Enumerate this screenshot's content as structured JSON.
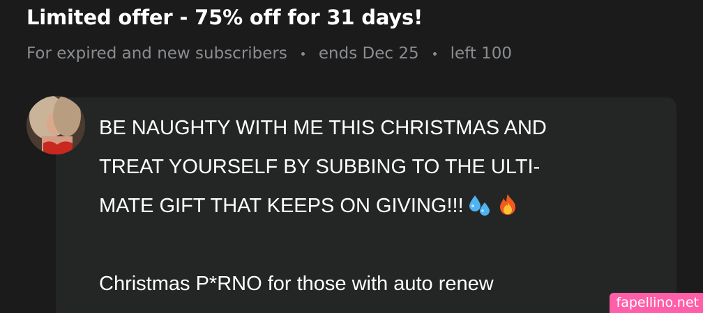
{
  "offer": {
    "title": "Limited offer - 75% off for 31 days!",
    "audience": "For expired and new subscribers",
    "ends": "ends Dec 25",
    "left": "left 100"
  },
  "post": {
    "lines": [
      "BE NAUGHTY WITH ME THIS CHRISTMAS AND",
      "TREAT YOURSELF BY SUBBING TO THE ULTI-",
      "MATE GIFT THAT KEEPS ON GIVING!!!",
      "",
      "Christmas P*RNO for those with auto renew"
    ],
    "emojis": [
      "sweat-droplets-icon",
      "fire-icon"
    ]
  },
  "watermark": "fapellino.net",
  "colors": {
    "background": "#1b1b1b",
    "bubble": "#242626",
    "meta_text": "#8a8d91",
    "watermark_bg": "#ff5fa8"
  }
}
